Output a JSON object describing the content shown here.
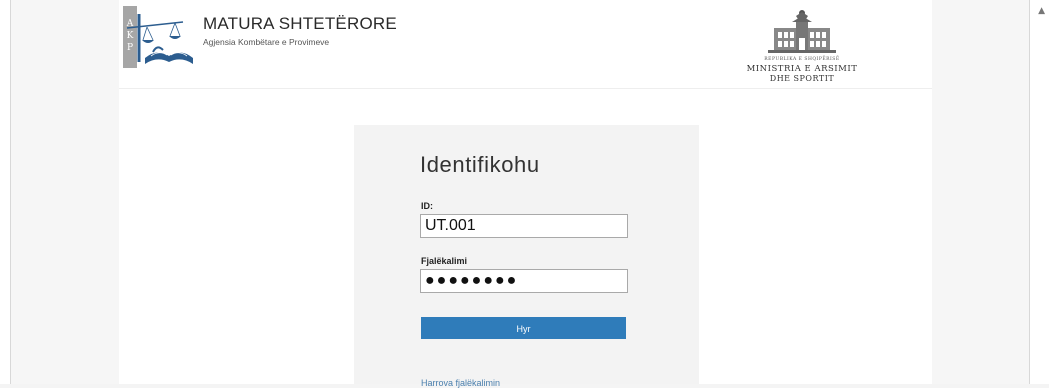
{
  "header": {
    "logo_letters": [
      "A",
      "K",
      "P"
    ],
    "title": "MATURA SHTETËRORE",
    "subtitle": "Agjensia Kombëtare e Provimeve",
    "ministry": {
      "line1": "REPUBLIKA E SHQIPËRISË",
      "line2": "MINISTRIA E ARSIMIT",
      "line3": "DHE SPORTIT"
    }
  },
  "login": {
    "title": "Identifikohu",
    "id_label": "ID:",
    "id_value": "UT.001",
    "password_label": "Fjalëkalimi",
    "password_value": "●●●●●●●●",
    "submit_label": "Hyr",
    "forgot_label": "Harrova fjalëkalimin"
  },
  "colors": {
    "accent": "#2f7cba",
    "link": "#4a7fad",
    "logo_blue": "#2c5d8f",
    "logo_grey": "#a6a6a6"
  }
}
